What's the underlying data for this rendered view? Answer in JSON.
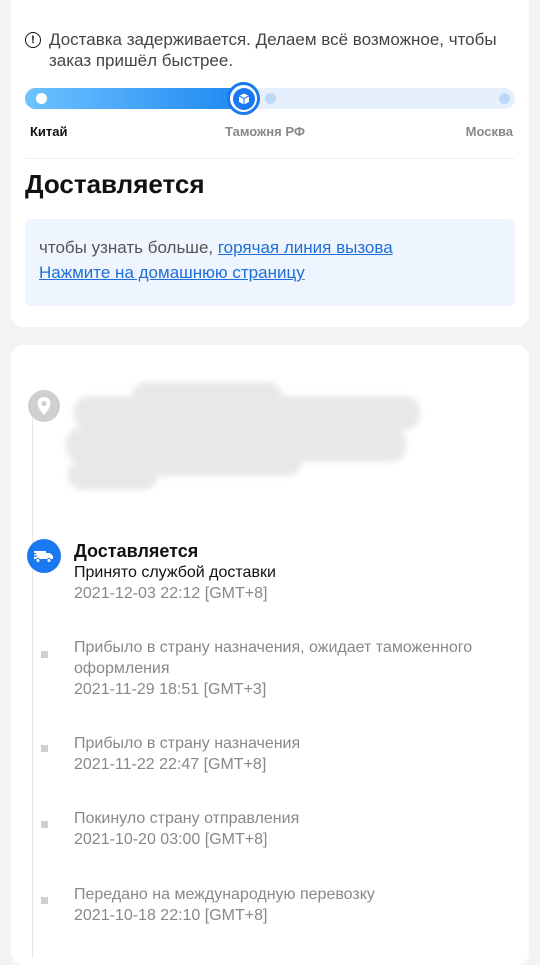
{
  "notice": {
    "icon": "alert-circle-icon",
    "text": "Доставка задерживается. Делаем всё возможное, чтобы заказ пришёл быстрее."
  },
  "progress": {
    "fraction": 0.44,
    "stages": [
      {
        "label": "Китай",
        "active": true
      },
      {
        "label": "Таможня РФ",
        "active": false
      },
      {
        "label": "Москва",
        "active": false
      }
    ],
    "accent_color": "#1a78f0"
  },
  "status": {
    "title": "Доставляется"
  },
  "info": {
    "prefix": "чтобы узнать больше, ",
    "hotline_link": "горячая линия вызова",
    "home_link": "Нажмите на домашнюю страницу"
  },
  "timeline": {
    "current": {
      "icon": "delivery-truck-icon",
      "title": "Доставляется",
      "desc": "Принято службой доставки",
      "time": "2021-12-03 22:12 [GMT+8]"
    },
    "events": [
      {
        "desc": "Прибыло в страну назначения, ожидает таможенного оформления",
        "time": "2021-11-29 18:51 [GMT+3]"
      },
      {
        "desc": "Прибыло в страну назначения",
        "time": "2021-11-22 22:47 [GMT+8]"
      },
      {
        "desc": "Покинуло страну отправления",
        "time": "2021-10-20 03:00 [GMT+8]"
      },
      {
        "desc": "Передано на международную перевозку",
        "time": "2021-10-18 22:10 [GMT+8]"
      }
    ]
  }
}
